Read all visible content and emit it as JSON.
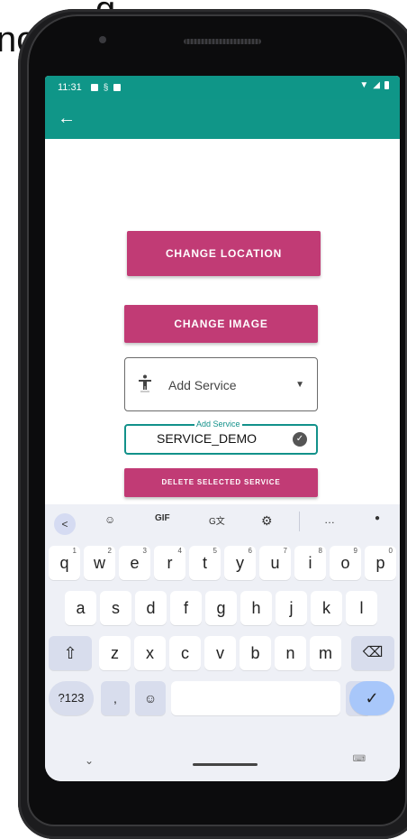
{
  "background_text": {
    "line1": "g",
    "line2": "no"
  },
  "status_bar": {
    "time": "11:31"
  },
  "app_bar": {
    "back_icon": "←"
  },
  "buttons": {
    "change_location": "CHANGE LOCATION",
    "change_image": "CHANGE IMAGE",
    "delete_service": "DELETE SELECTED SERVICE"
  },
  "service_select": {
    "value": "Add Service",
    "icon": "accessibility-icon"
  },
  "service_input": {
    "label": "Add Service",
    "value": "SERVICE_DEMO"
  },
  "keyboard": {
    "toolbar": {
      "back": "<",
      "sticker": "☺",
      "gif": "GIF",
      "translate": "G文",
      "settings": "⚙",
      "more": "…",
      "mic": "●"
    },
    "row1": [
      {
        "key": "q",
        "num": "1"
      },
      {
        "key": "w",
        "num": "2"
      },
      {
        "key": "e",
        "num": "3"
      },
      {
        "key": "r",
        "num": "4"
      },
      {
        "key": "t",
        "num": "5"
      },
      {
        "key": "y",
        "num": "6"
      },
      {
        "key": "u",
        "num": "7"
      },
      {
        "key": "i",
        "num": "8"
      },
      {
        "key": "o",
        "num": "9"
      },
      {
        "key": "p",
        "num": "0"
      }
    ],
    "row2": [
      "a",
      "s",
      "d",
      "f",
      "g",
      "h",
      "j",
      "k",
      "l"
    ],
    "row3": [
      "z",
      "x",
      "c",
      "v",
      "b",
      "n",
      "m"
    ],
    "shift": "⇧",
    "backspace": "⌫",
    "sym": "?123",
    "comma": ",",
    "emoji": "☺",
    "period": ".",
    "enter": "✓"
  },
  "colors": {
    "app_bar": "#109688",
    "button": "#c13b75",
    "accent": "#12918a"
  }
}
